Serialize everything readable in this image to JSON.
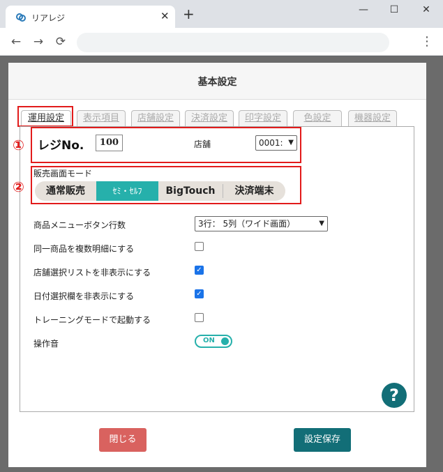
{
  "browser": {
    "tab_title": "リアレジ",
    "tab_close": "✕",
    "new_tab": "+",
    "window_minimize": "—",
    "window_maximize": "☐",
    "window_close": "✕",
    "back": "←",
    "forward": "→",
    "reload": "⟳",
    "menu": "⋮"
  },
  "dialog": {
    "title": "基本設定",
    "tabs": [
      {
        "label": "運用設定",
        "active": true
      },
      {
        "label": "表示項目",
        "active": false
      },
      {
        "label": "店舗設定",
        "active": false
      },
      {
        "label": "決済設定",
        "active": false
      },
      {
        "label": "印字設定",
        "active": false
      },
      {
        "label": "色設定",
        "active": false
      },
      {
        "label": "機器設定",
        "active": false
      }
    ]
  },
  "annotations": {
    "marker1": "①",
    "marker2": "②",
    "color": "#e21b1b"
  },
  "settings": {
    "regi_label": "レジNo.",
    "regi_value": "100",
    "store_label": "店舗",
    "store_value": "0001:",
    "mode_label": "販売画面モード",
    "modes": [
      "通常販売",
      "ｾﾐ・ｾﾙﾌ",
      "BigTouch",
      "決済端末"
    ],
    "selected_mode": "ｾﾐ・ｾﾙﾌ",
    "menu_rows_label": "商品メニューボタン行数",
    "menu_rows_value": "3行： 5列（ワイド画面）",
    "same_item_label": "同一商品を複数明細にする",
    "same_item_checked": false,
    "hide_store_list_label": "店舗選択リストを非表示にする",
    "hide_store_list_checked": true,
    "hide_date_label": "日付選択欄を非表示にする",
    "hide_date_checked": true,
    "training_label": "トレーニングモードで起動する",
    "training_checked": false,
    "sound_label": "操作音",
    "sound_value": "ON"
  },
  "buttons": {
    "help": "?",
    "close": "閉じる",
    "save": "設定保存"
  },
  "colors": {
    "accent": "#26b0ab",
    "primary": "#126e77",
    "danger": "#d9625f",
    "checkbox": "#1a73e8"
  }
}
